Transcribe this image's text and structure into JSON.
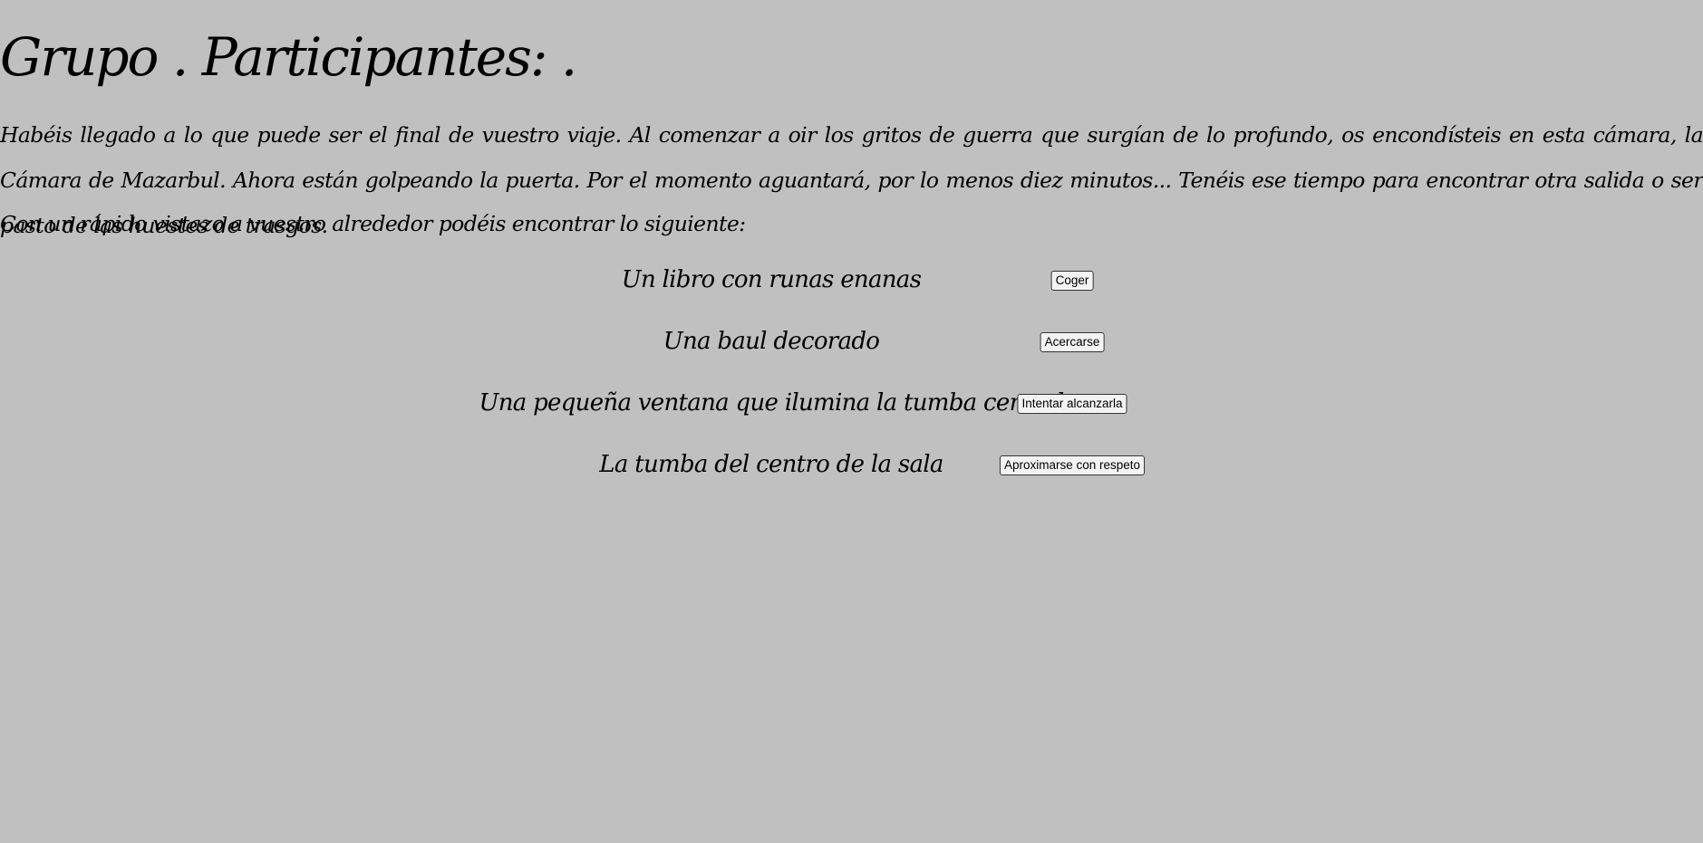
{
  "heading": "Grupo . Participantes: .",
  "intro": "Habéis llegado a lo que puede ser el final de vuestro viaje. Al comenzar a oir los gritos de guerra que surgían de lo profundo, os encondísteis en esta cámara, la Cámara de Mazarbul. Ahora están golpeando la puerta. Por el momento aguantará, por lo menos diez minutos... Tenéis ese tiempo para encontrar otra salida o ser pasto de las huestes de trasgos.",
  "subintro": "Con un rápido vistazo a vuestro alrededor podéis encontrar lo siguiente:",
  "options": [
    {
      "label": "Un libro con runas enanas",
      "action": "Coger"
    },
    {
      "label": "Una baul decorado",
      "action": "Acercarse"
    },
    {
      "label": "Una pequeña ventana que ilumina la tumba central",
      "action": "Intentar alcanzarla"
    },
    {
      "label": "La tumba del centro de la sala",
      "action": "Aproximarse con respeto"
    }
  ],
  "colors": {
    "background": "#c0c0c0",
    "text": "#000000"
  }
}
